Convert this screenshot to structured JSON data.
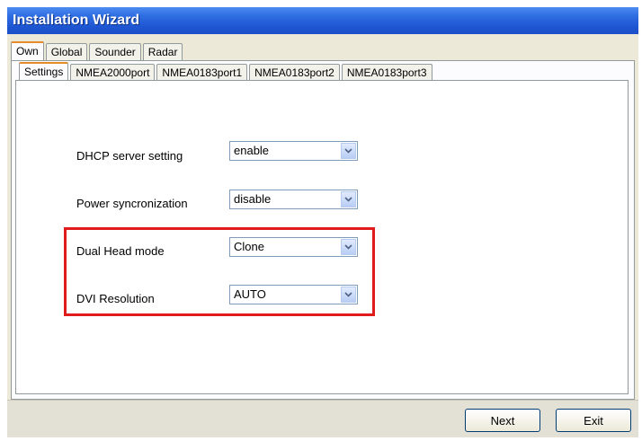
{
  "window": {
    "title": "Installation Wizard"
  },
  "outer_tabs": [
    {
      "label": "Own",
      "active": true
    },
    {
      "label": "Global",
      "active": false
    },
    {
      "label": "Sounder",
      "active": false
    },
    {
      "label": "Radar",
      "active": false
    }
  ],
  "inner_tabs": [
    {
      "label": "Settings",
      "active": true
    },
    {
      "label": "NMEA2000port",
      "active": false
    },
    {
      "label": "NMEA0183port1",
      "active": false
    },
    {
      "label": "NMEA0183port2",
      "active": false
    },
    {
      "label": "NMEA0183port3",
      "active": false
    }
  ],
  "settings": {
    "dhcp": {
      "label": "DHCP server setting",
      "value": "enable"
    },
    "power": {
      "label": "Power syncronization",
      "value": "disable"
    },
    "dual_head": {
      "label": "Dual Head mode",
      "value": "Clone"
    },
    "dvi": {
      "label": "DVI Resolution",
      "value": "AUTO"
    }
  },
  "buttons": {
    "next": "Next",
    "exit": "Exit"
  },
  "colors": {
    "highlight": "#e01c1c",
    "titlebar": "#2f6fe3",
    "active_tab_accent": "#e68b2c"
  },
  "icons": {
    "combo_arrow": "chevron-down-icon"
  }
}
